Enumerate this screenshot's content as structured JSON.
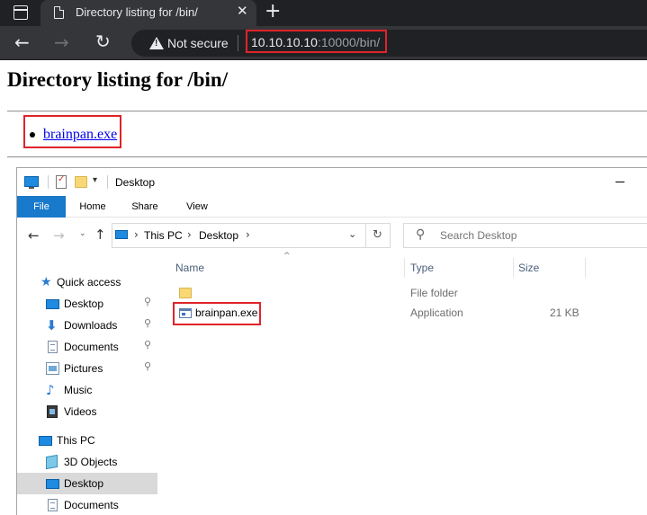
{
  "browser": {
    "tab_title": "Directory listing for /bin/",
    "close_glyph": "✕",
    "new_tab_glyph": "+",
    "back_glyph": "←",
    "forward_glyph": "→",
    "reload_glyph": "↻",
    "security_label": "Not secure",
    "url_host": "10.10.10.10",
    "url_rest": ":10000/bin/"
  },
  "page": {
    "heading": "Directory listing for /bin/",
    "links": [
      {
        "text": "brainpan.exe"
      }
    ]
  },
  "explorer": {
    "title": "Desktop",
    "quick_access_dropdown": "▾",
    "ribbon_tabs": [
      "File",
      "Home",
      "Share",
      "View"
    ],
    "nav": {
      "back": "←",
      "forward": "→",
      "recent": "⌄",
      "up": "↑",
      "crumbs": [
        "This PC",
        "Desktop"
      ],
      "crumb_sep": "›",
      "dropdown": "⌄",
      "refresh": "↻",
      "search_placeholder": "Search Desktop"
    },
    "navpane": [
      {
        "label": "Quick access",
        "icon": "quick-access-star-icon",
        "pinned": false
      },
      {
        "label": "Desktop",
        "icon": "desktop-icon",
        "pinned": true
      },
      {
        "label": "Downloads",
        "icon": "downloads-icon",
        "pinned": true
      },
      {
        "label": "Documents",
        "icon": "documents-icon",
        "pinned": true
      },
      {
        "label": "Pictures",
        "icon": "pictures-icon",
        "pinned": true
      },
      {
        "label": "Music",
        "icon": "music-icon",
        "pinned": false
      },
      {
        "label": "Videos",
        "icon": "videos-icon",
        "pinned": false
      },
      {
        "label": "This PC",
        "icon": "this-pc-icon",
        "pinned": false
      },
      {
        "label": "3D Objects",
        "icon": "3d-objects-icon",
        "pinned": false
      },
      {
        "label": "Desktop",
        "icon": "desktop-icon",
        "pinned": false,
        "selected": true
      },
      {
        "label": "Documents",
        "icon": "documents-icon",
        "pinned": false
      }
    ],
    "pin_glyph": "📌",
    "columns": {
      "name": "Name",
      "type": "Type",
      "size": "Size",
      "sort_glyph": "^"
    },
    "files": [
      {
        "name": "",
        "type": "File folder",
        "size": "",
        "icon": "folder-icon"
      },
      {
        "name": "brainpan.exe",
        "type": "Application",
        "size": "21 KB",
        "icon": "application-icon"
      }
    ]
  },
  "colors": {
    "highlight_box": "#e0232a",
    "ribbon_file_tab": "#1979ca",
    "link": "#0000ee"
  }
}
